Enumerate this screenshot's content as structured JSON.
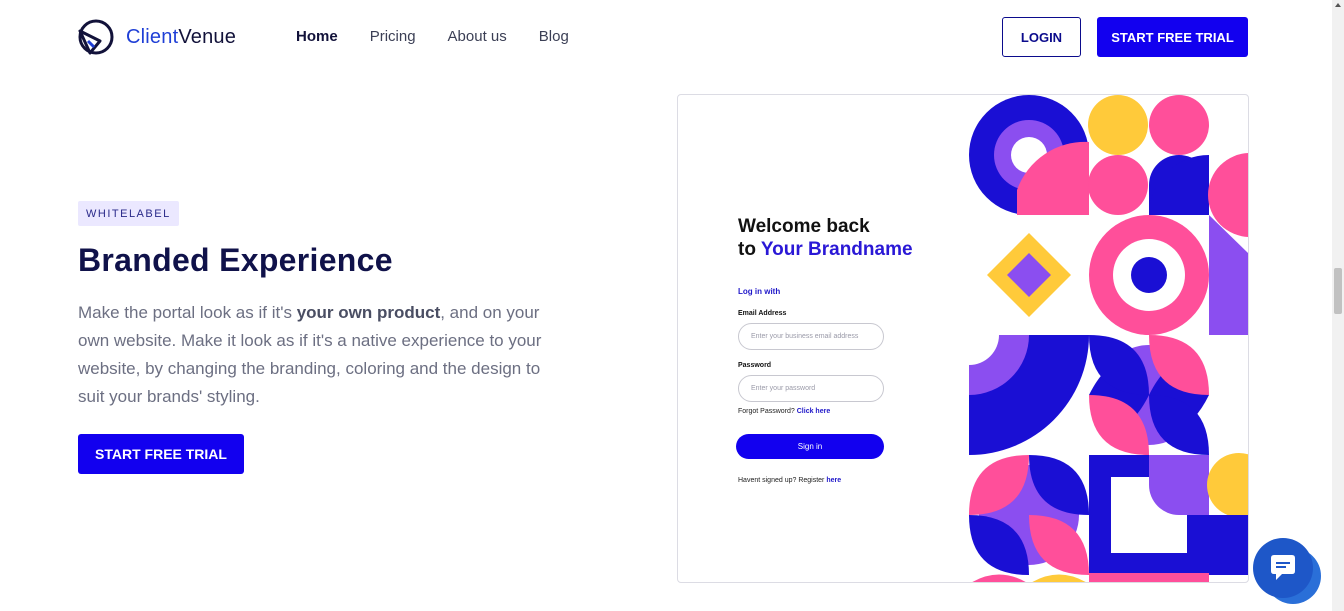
{
  "header": {
    "logo_text_accent": "Client",
    "logo_text_rest": "Venue",
    "nav": [
      {
        "label": "Home",
        "active": true
      },
      {
        "label": "Pricing",
        "active": false
      },
      {
        "label": "About us",
        "active": false
      },
      {
        "label": "Blog",
        "active": false
      }
    ],
    "login_label": "LOGIN",
    "trial_label": "START FREE TRIAL"
  },
  "hero": {
    "badge": "WHITELABEL",
    "title": "Branded Experience",
    "desc_part1": "Make the portal look as if it's ",
    "desc_bold": "your own product",
    "desc_part2": ", and on your own website. Make it look as if it's a native experience to your website, by changing the branding, coloring and the design to suit your brands' styling.",
    "cta_label": "START FREE TRIAL"
  },
  "preview": {
    "welcome_line1": "Welcome back",
    "welcome_to": "to ",
    "welcome_brand": "Your Brandname",
    "login_with": "Log in with",
    "email_label": "Email Address",
    "email_placeholder": "Enter your business email address",
    "password_label": "Password",
    "password_placeholder": "Enter your password",
    "forgot_text": "Forgot Password? ",
    "forgot_link": "Click here",
    "signin_label": "Sign in",
    "register_text": "Havent signed up? Register ",
    "register_link": "here"
  },
  "chat": {
    "icon": "chat-bubble-icon"
  },
  "colors": {
    "primary": "#1200ef",
    "navy": "#10124a",
    "badge_bg": "#ebe8ff",
    "pattern_blue": "#1a0fd4",
    "pattern_pink": "#ff4f9a",
    "pattern_purple": "#8b4ef0",
    "pattern_yellow": "#ffca3a"
  }
}
